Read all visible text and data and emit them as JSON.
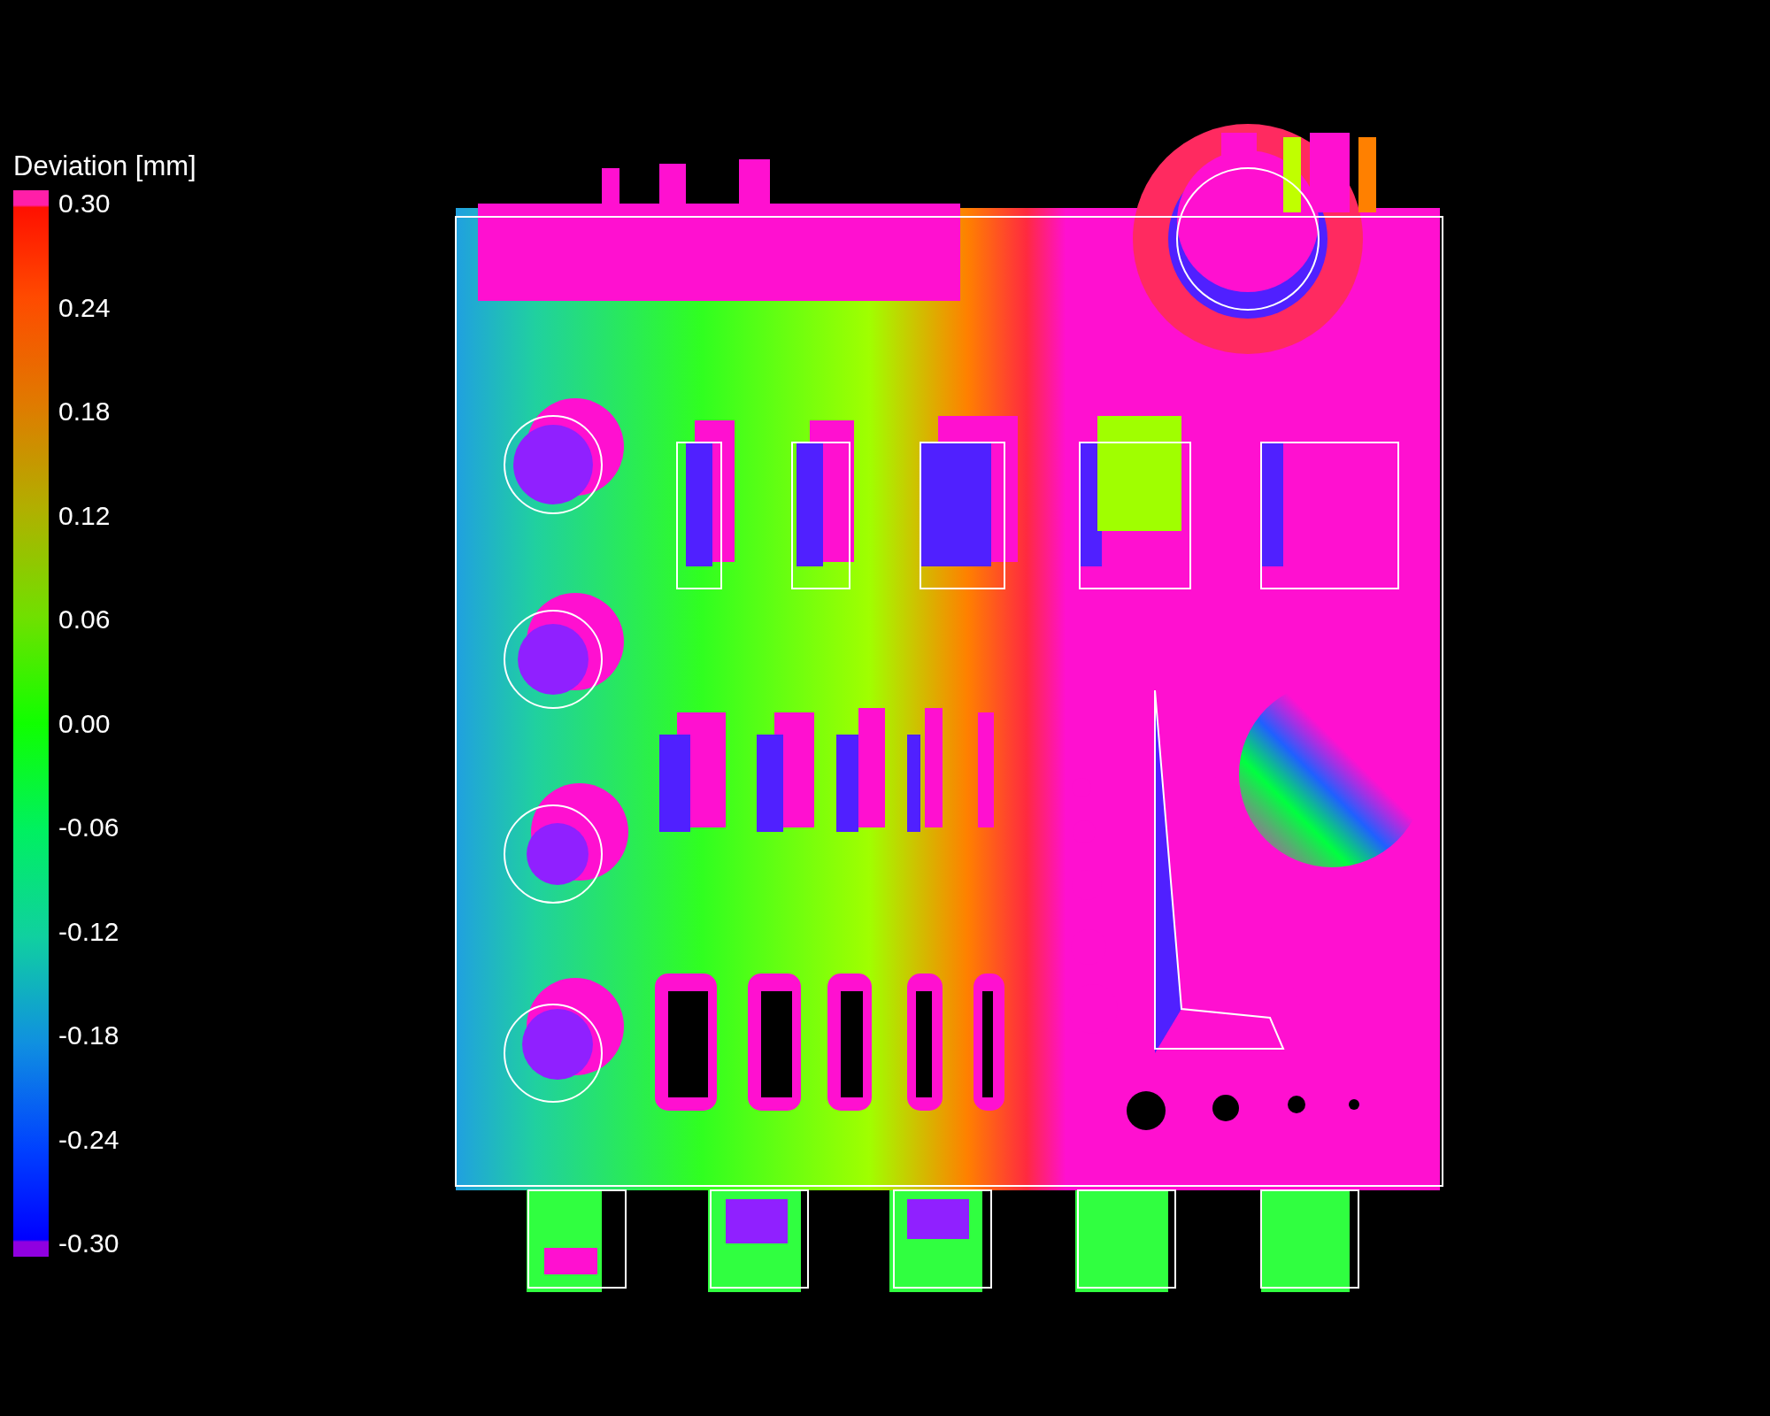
{
  "legend": {
    "title": "Deviation [mm]",
    "labels": [
      "0.30",
      "0.24",
      "0.18",
      "0.12",
      "0.06",
      "0.00",
      "-0.06",
      "-0.12",
      "-0.18",
      "-0.24",
      "-0.30"
    ]
  }
}
